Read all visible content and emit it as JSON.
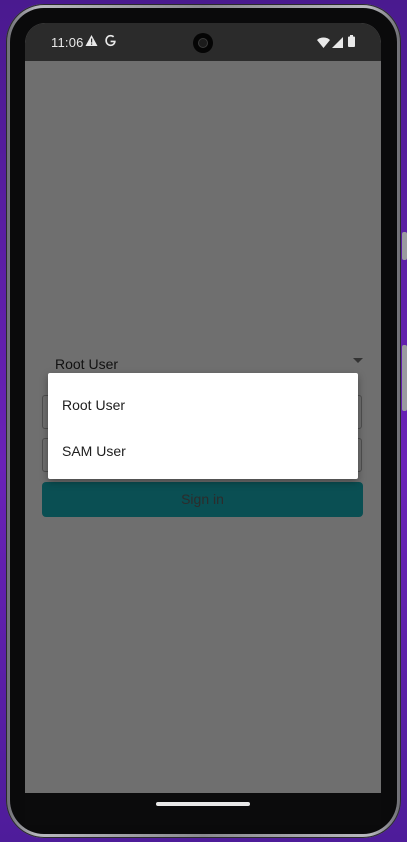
{
  "status_bar": {
    "time": "11:06",
    "icons": [
      "warning-icon",
      "google-g-icon",
      "wifi-icon",
      "cell-signal-icon",
      "battery-icon"
    ]
  },
  "login": {
    "user_type_selected": "Root User",
    "signin_label": "Sign in"
  },
  "dropdown": {
    "options": [
      "Root User",
      "SAM User"
    ]
  },
  "colors": {
    "scrim": "#6f6f6f",
    "signin_button": "#0a4f53",
    "status_bar": "#2b2b2b"
  }
}
